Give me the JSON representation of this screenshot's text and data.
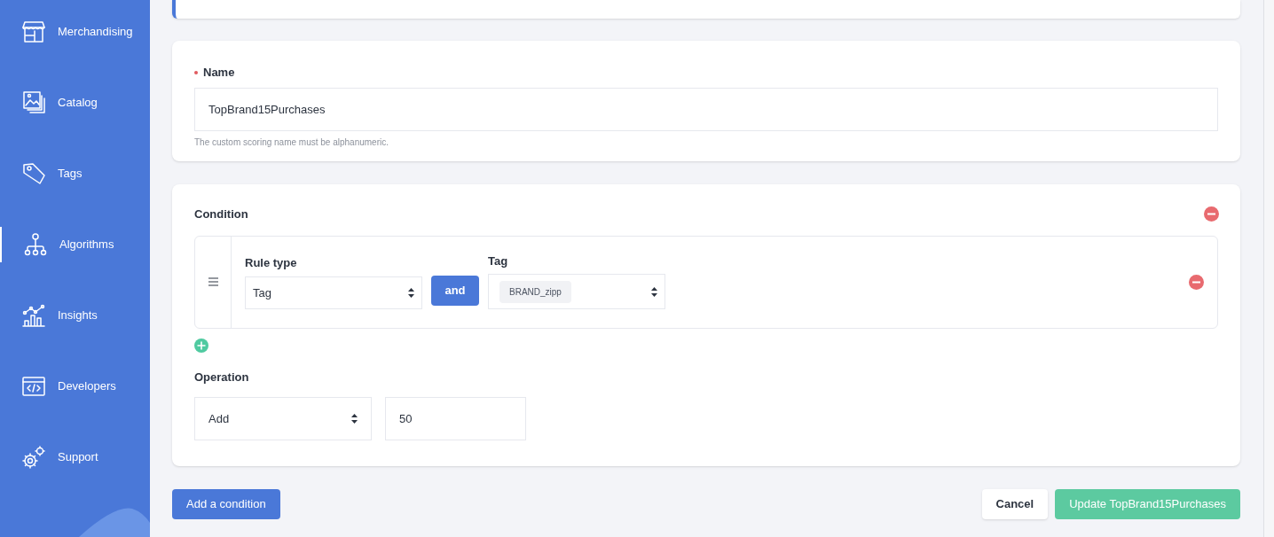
{
  "sidebar": {
    "items": [
      {
        "label": "Merchandising",
        "selected": false
      },
      {
        "label": "Catalog",
        "selected": false
      },
      {
        "label": "Tags",
        "selected": false
      },
      {
        "label": "Algorithms",
        "selected": true
      },
      {
        "label": "Insights",
        "selected": false
      },
      {
        "label": "Developers",
        "selected": false
      },
      {
        "label": "Support",
        "selected": false
      }
    ]
  },
  "name_section": {
    "label": "Name",
    "required": true,
    "value": "TopBrand15Purchases",
    "help": "The custom scoring name must be alphanumeric."
  },
  "condition_section": {
    "title": "Condition",
    "rules": [
      {
        "rule_type_label": "Rule type",
        "rule_type": "Tag",
        "joiner": "and",
        "tag_label": "Tag",
        "tags": [
          "BRAND_zipp"
        ]
      }
    ]
  },
  "operation_section": {
    "title": "Operation",
    "operation": "Add",
    "value": "50"
  },
  "footer": {
    "add_condition": "Add a condition",
    "cancel": "Cancel",
    "submit": "Update TopBrand15Purchases"
  }
}
